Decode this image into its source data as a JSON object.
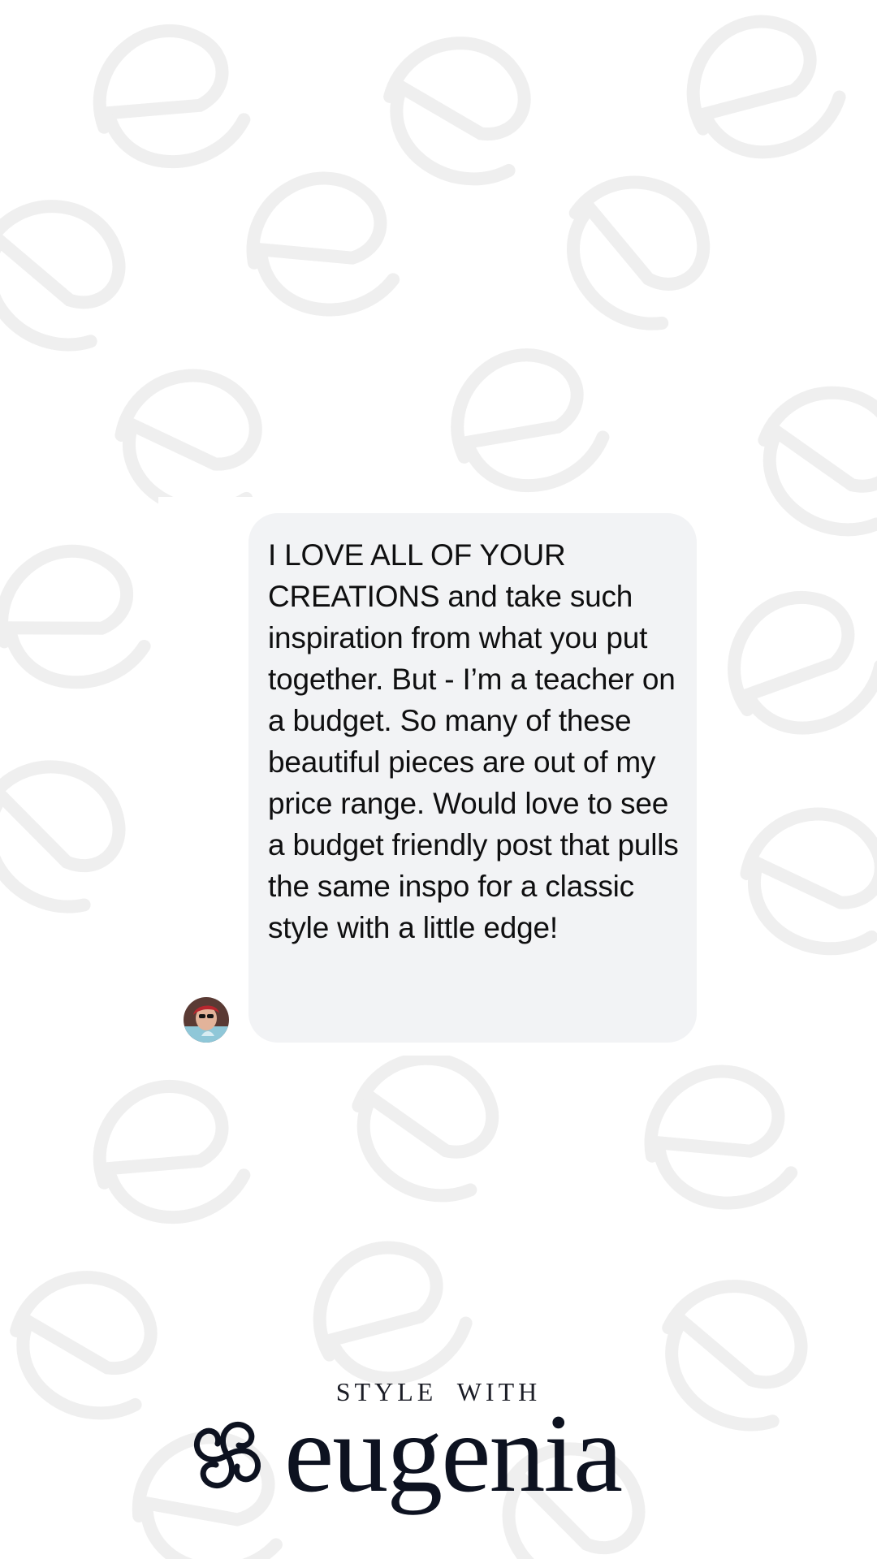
{
  "message": {
    "text": "I LOVE ALL OF YOUR CREATIONS and take such inspiration from what you put together. But - I’m a teacher on a budget. So many of these beautiful pieces are out of my price range. Would love to see a budget friendly post that pulls the same inspo for a classic style with a little edge!",
    "sender_avatar_icon": "user-avatar"
  },
  "brand": {
    "tagline": "STYLE WITH",
    "name": "eugenia",
    "mark_icon": "swirl-logo-mark"
  },
  "colors": {
    "bubble_bg": "#f2f3f5",
    "text": "#0f0f10",
    "brand_ink": "#0d1220",
    "pattern": "#ececec"
  }
}
